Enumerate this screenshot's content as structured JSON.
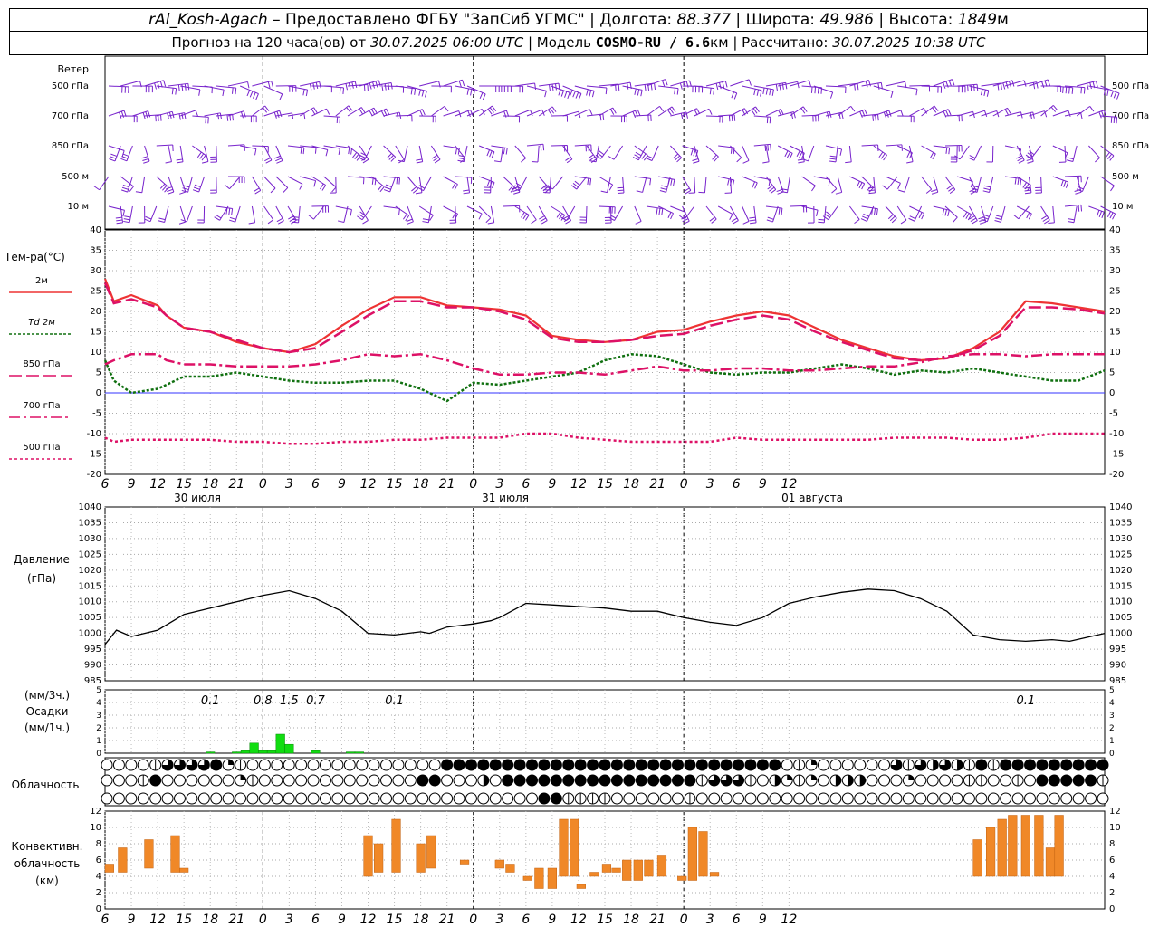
{
  "header": {
    "station": "rAl_Kosh-Agach",
    "provider": " – Предоставлено ФГБУ \"ЗапСиб УГМС\" | Долгота: ",
    "lon": "88.377",
    "lat_label": " | Широта: ",
    "lat": "49.986",
    "alt_label": " | Высота: ",
    "alt": "1849",
    "alt_unit": "м",
    "forecast_label": "Прогноз на 120 часа(ов) от ",
    "forecast_time": "30.07.2025 06:00 UTC",
    "model_label": "  | Модель ",
    "model": "COSMO-RU / 6.6",
    "model_unit": "км",
    "calc_label": " | Рассчитано: ",
    "calc_time": "30.07.2025 10:38 UTC"
  },
  "colors": {
    "t2m": "#ee3333",
    "td2m": "#107010",
    "t850": "#dd1166",
    "t700": "#dd1166",
    "t500": "#dd1166",
    "pressure": "#000000",
    "precip": "#11dd11",
    "convective": "#f08828",
    "wind": "#7722cc",
    "zero_line": "#3333ff"
  },
  "time_axis": {
    "hours": [
      6,
      9,
      12,
      15,
      18,
      21,
      0,
      3,
      6,
      9,
      12,
      15,
      18,
      21,
      0,
      3,
      6,
      9,
      12,
      15,
      18,
      21,
      0,
      3,
      6,
      9,
      12
    ],
    "tick_labels": [
      "6",
      "9",
      "12",
      "15",
      "18",
      "21",
      "0",
      "3",
      "6",
      "9",
      "12",
      "15",
      "18",
      "21",
      "0",
      "3",
      "6",
      "9",
      "12",
      "15",
      "18",
      "21",
      "0",
      "3",
      "6",
      "9",
      "12"
    ],
    "dates": [
      "30 июля",
      "31 июля",
      "01 августа"
    ]
  },
  "wind_panel": {
    "title": "Ветер",
    "levels": [
      "500 гПа",
      "700 гПа",
      "850 гПа",
      "500  м",
      "10   м"
    ]
  },
  "temp_panel": {
    "ylabel": "Тем-ра(°С)",
    "legend": [
      "2м",
      "Td  2м",
      "850 гПа",
      "700 гПа",
      "500 гПа"
    ]
  },
  "pressure_panel": {
    "ylabel_1": "Давление",
    "ylabel_2": "(гПа)"
  },
  "precip_panel": {
    "ylabel_1": "(мм/3ч.)",
    "ylabel_2": "Осадки",
    "ylabel_3": "(мм/1ч.)",
    "annotations": [
      {
        "hour": 12,
        "text": "0.1"
      },
      {
        "hour": 18,
        "text": "0.8"
      },
      {
        "hour": 21,
        "text": "1.5"
      },
      {
        "hour": 24,
        "text": "0.7"
      },
      {
        "hour": 33,
        "text": "0.1"
      },
      {
        "hour": 105,
        "text": "0.1"
      }
    ]
  },
  "cloud_panel": {
    "label": "Облачность"
  },
  "conv_panel": {
    "ylabel_1": "Конвективн.",
    "ylabel_2": "облачность",
    "ylabel_3": "(км)"
  },
  "chart_data": [
    {
      "type": "line",
      "title": "Тем-ра(°С)",
      "ylim": [
        -20,
        40
      ],
      "x_hours": [
        0,
        1,
        3,
        6,
        7,
        9,
        12,
        15,
        18,
        21,
        24,
        27,
        30,
        33,
        36,
        39,
        42,
        45,
        48,
        51,
        54,
        57,
        60,
        63,
        66,
        69,
        72,
        75,
        78,
        81,
        84,
        87,
        90,
        93,
        96,
        99,
        102,
        105,
        108,
        111,
        114
      ],
      "series": [
        {
          "name": "2м",
          "values": [
            28,
            22.5,
            24,
            21.5,
            19,
            16,
            15,
            12.5,
            11,
            10,
            12,
            16.5,
            20.5,
            23.5,
            23.5,
            21.5,
            21,
            20.5,
            19,
            14,
            13,
            12.5,
            13,
            15,
            15.5,
            17.5,
            19,
            20,
            19,
            16,
            13,
            11,
            9,
            8,
            8.5,
            11,
            15,
            22.5,
            22,
            21,
            20
          ]
        },
        {
          "name": "Td  2м",
          "values": [
            8,
            3,
            0,
            1,
            2,
            4,
            4,
            5,
            4,
            3,
            2.5,
            2.5,
            3,
            3,
            1,
            -2,
            2.5,
            2,
            3,
            4,
            5,
            8,
            9.5,
            9,
            7,
            5,
            4.5,
            5,
            5,
            6,
            7,
            6,
            4.5,
            5.5,
            5,
            6,
            5,
            4,
            3,
            3,
            5.5
          ]
        },
        {
          "name": "850 гПа",
          "values": [
            27,
            22,
            23,
            21,
            19,
            16,
            15,
            13,
            11,
            10,
            11,
            15,
            19,
            22.5,
            22.5,
            21,
            21,
            20,
            18,
            13.5,
            12.5,
            12.5,
            13,
            14,
            14.5,
            16.5,
            18,
            19,
            18,
            15,
            12.5,
            10.5,
            8.5,
            8,
            8.5,
            10.5,
            14,
            21,
            21,
            20.5,
            19.5
          ]
        },
        {
          "name": "700 гПа",
          "values": [
            7,
            8,
            9.5,
            9.5,
            8,
            7,
            7,
            6.5,
            6.5,
            6.5,
            7,
            8,
            9.5,
            9,
            9.5,
            8,
            6,
            4.5,
            4.5,
            5,
            5,
            4.5,
            5.5,
            6.5,
            5.5,
            5.5,
            6,
            6,
            5.5,
            5.5,
            6,
            6.5,
            6.5,
            7.5,
            9,
            9.5,
            9.5,
            9,
            9.5,
            9.5,
            9.5
          ]
        },
        {
          "name": "500 гПа",
          "values": [
            -11,
            -12,
            -11.5,
            -11.5,
            -11.5,
            -11.5,
            -11.5,
            -12,
            -12,
            -12.5,
            -12.5,
            -12,
            -12,
            -11.5,
            -11.5,
            -11,
            -11,
            -11,
            -10,
            -10,
            -11,
            -11.5,
            -12,
            -12,
            -12,
            -12,
            -11,
            -11.5,
            -11.5,
            -11.5,
            -11.5,
            -11.5,
            -11,
            -11,
            -11,
            -11.5,
            -11.5,
            -11,
            -10,
            -10,
            -10
          ]
        }
      ]
    },
    {
      "type": "line",
      "title": "Давление",
      "ylabel": "(гПа)",
      "ylim": [
        985,
        1040
      ],
      "x_hours": [
        0,
        1.3,
        3,
        6,
        9,
        12,
        15,
        18,
        21,
        24,
        27,
        30,
        33,
        36,
        37,
        39,
        42,
        44,
        45,
        48,
        51,
        54,
        57,
        60,
        63,
        66,
        69,
        72,
        75,
        78,
        81,
        84,
        87,
        90,
        93,
        96,
        99,
        102,
        105,
        108,
        110,
        114
      ],
      "series": [
        {
          "name": "Давление",
          "values": [
            996.5,
            1001,
            999,
            1001,
            1006,
            1008,
            1010,
            1012,
            1013.5,
            1011,
            1007,
            1000,
            999.5,
            1000.5,
            1000,
            1002,
            1003,
            1004,
            1005,
            1009.5,
            1009,
            1008.5,
            1008,
            1007,
            1007,
            1005,
            1003.5,
            1002.5,
            1005,
            1009.5,
            1011.5,
            1013,
            1014,
            1013.5,
            1011,
            1007,
            999.5,
            998,
            997.5,
            998,
            997.5,
            1000
          ]
        }
      ]
    },
    {
      "type": "bar",
      "title": "Осадки",
      "ylabel": "(мм/1ч.)",
      "ylim": [
        0,
        5
      ],
      "x_hours": [
        12,
        15,
        16,
        17,
        18,
        19,
        20,
        21,
        24,
        28,
        29
      ],
      "values": [
        0.1,
        0.1,
        0.2,
        0.8,
        0.2,
        0.2,
        1.5,
        0.7,
        0.2,
        0.1,
        0.1
      ],
      "series": [
        {
          "name": "(мм/1ч.)",
          "values": [
            0.1,
            0.1,
            0.2,
            0.8,
            0.2,
            0.2,
            1.5,
            0.7,
            0.2,
            0.1,
            0.1
          ]
        }
      ]
    },
    {
      "type": "bar",
      "title": "Конвективн. облачность",
      "ylabel": "(км)",
      "ylim": [
        0,
        12
      ],
      "bars": [
        {
          "x": 0.5,
          "lo": 4.5,
          "hi": 5.5
        },
        {
          "x": 2,
          "lo": 4.5,
          "hi": 7.5
        },
        {
          "x": 5,
          "lo": 5,
          "hi": 8.5
        },
        {
          "x": 8,
          "lo": 4.5,
          "hi": 9
        },
        {
          "x": 9,
          "lo": 4.5,
          "hi": 5
        },
        {
          "x": 30,
          "lo": 4,
          "hi": 9
        },
        {
          "x": 31.2,
          "lo": 4.5,
          "hi": 8
        },
        {
          "x": 33.2,
          "lo": 4.5,
          "hi": 11
        },
        {
          "x": 36,
          "lo": 4.5,
          "hi": 8
        },
        {
          "x": 37.2,
          "lo": 5,
          "hi": 9
        },
        {
          "x": 41,
          "lo": 5.5,
          "hi": 6
        },
        {
          "x": 45,
          "lo": 5,
          "hi": 6
        },
        {
          "x": 46.2,
          "lo": 4.5,
          "hi": 5.5
        },
        {
          "x": 48.2,
          "lo": 3.5,
          "hi": 4
        },
        {
          "x": 49.5,
          "lo": 2.5,
          "hi": 5
        },
        {
          "x": 51,
          "lo": 2.5,
          "hi": 5
        },
        {
          "x": 52.3,
          "lo": 4,
          "hi": 11
        },
        {
          "x": 53.5,
          "lo": 4,
          "hi": 11
        },
        {
          "x": 54.3,
          "lo": 2.5,
          "hi": 3
        },
        {
          "x": 55.8,
          "lo": 4,
          "hi": 4.5
        },
        {
          "x": 57.2,
          "lo": 4.5,
          "hi": 5.5
        },
        {
          "x": 58.3,
          "lo": 4.5,
          "hi": 5
        },
        {
          "x": 59.5,
          "lo": 3.5,
          "hi": 6
        },
        {
          "x": 60.8,
          "lo": 3.5,
          "hi": 6
        },
        {
          "x": 62,
          "lo": 4,
          "hi": 6
        },
        {
          "x": 63.5,
          "lo": 4,
          "hi": 6.5
        },
        {
          "x": 65.8,
          "lo": 3.5,
          "hi": 4
        },
        {
          "x": 67,
          "lo": 3.5,
          "hi": 10
        },
        {
          "x": 68.2,
          "lo": 4,
          "hi": 9.5
        },
        {
          "x": 69.5,
          "lo": 4,
          "hi": 4.5
        },
        {
          "x": 99.5,
          "lo": 4,
          "hi": 8.5
        },
        {
          "x": 101,
          "lo": 4,
          "hi": 10
        },
        {
          "x": 102.3,
          "lo": 4,
          "hi": 11
        },
        {
          "x": 103.5,
          "lo": 4,
          "hi": 11.5
        },
        {
          "x": 105,
          "lo": 4,
          "hi": 11.5
        },
        {
          "x": 106.5,
          "lo": 4,
          "hi": 11.5
        },
        {
          "x": 107.8,
          "lo": 4,
          "hi": 7.5
        },
        {
          "x": 108.8,
          "lo": 4,
          "hi": 11.5
        }
      ]
    }
  ],
  "cloud_rows": [
    "0000LC3CCFSL0000000000000000FFFFFFFFFFFFFFFFFFFFFFFFFFFF0LS000000CLTDCDLFLFFFFFFFFFFTTTTT",
    "000LF000000SL0000000000000FF000H0FFFFFFFFFFFFFFFFLCCTL0HSLS0HHH000S0000LL00L0FFFFFL",
    "000000000000000000000000000000000000FFLLLL000000L0000000000000000000000000000000000"
  ]
}
